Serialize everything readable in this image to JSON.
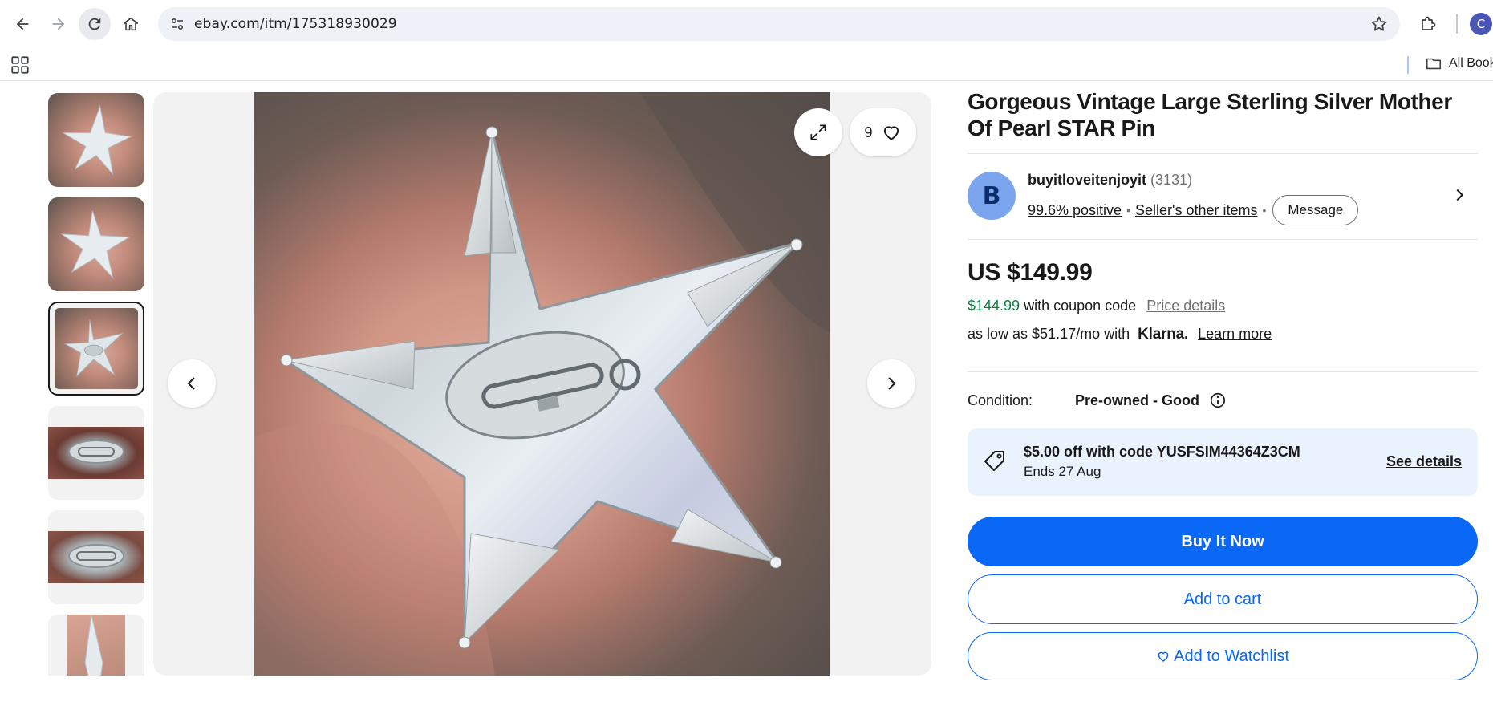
{
  "browser": {
    "url": "ebay.com/itm/175318930029",
    "profile_initial": "C",
    "bookmarks_label": "All Bookmarks"
  },
  "gallery": {
    "watch_count": "9",
    "thumbnail_count": 6,
    "selected_index": 2
  },
  "listing": {
    "title": "Gorgeous Vintage Large Sterling Silver Mother Of Pearl STAR Pin"
  },
  "seller": {
    "avatar_initial": "B",
    "name": "buyitloveitenjoyit",
    "feedback_count": "(3131)",
    "positive": "99.6% positive",
    "other_items": "Seller's other items",
    "message_label": "Message"
  },
  "price": {
    "amount": "US $149.99",
    "coupon_price": "$144.99",
    "coupon_text": "with coupon code",
    "price_details": "Price details",
    "klarna_prefix": "as low as $51.17/mo with",
    "klarna_brand": "Klarna.",
    "learn_more": "Learn more"
  },
  "condition": {
    "label": "Condition:",
    "value": "Pre-owned - Good"
  },
  "promo": {
    "title": "$5.00 off with code YUSFSIM44364Z3CM",
    "ends": "Ends 27 Aug",
    "see_details": "See details"
  },
  "actions": {
    "buy_now": "Buy It Now",
    "add_to_cart": "Add to cart",
    "add_to_watchlist": "Add to Watchlist"
  },
  "colors": {
    "ebay_blue": "#0968f6",
    "coupon_green": "#05823f",
    "promo_bg": "#e9f2fd"
  }
}
